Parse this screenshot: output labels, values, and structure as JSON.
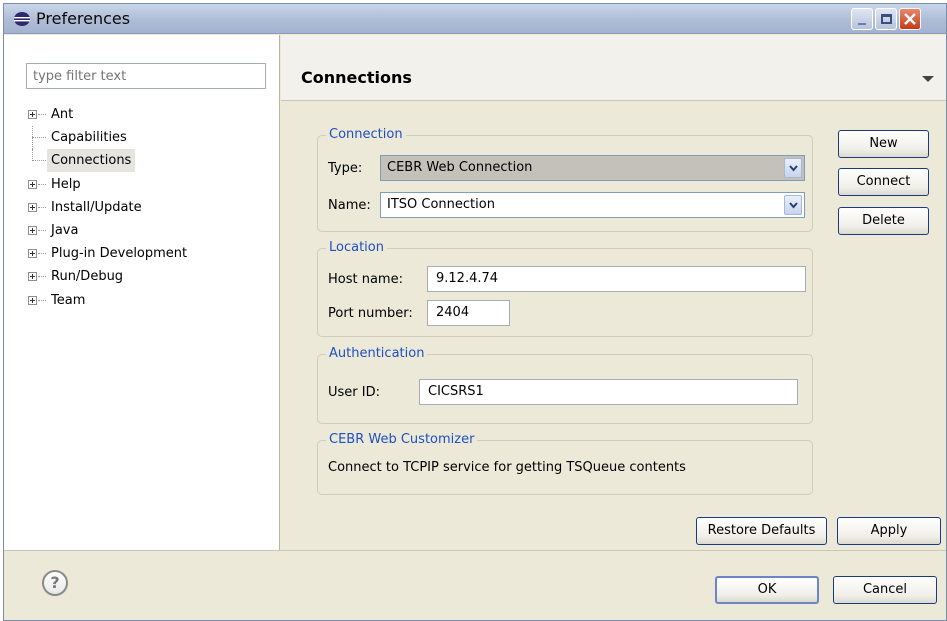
{
  "window": {
    "title": "Preferences",
    "icon": "eclipse-icon"
  },
  "filter": {
    "placeholder": "type filter text"
  },
  "tree": {
    "items": [
      {
        "label": "Ant",
        "expandable": true
      },
      {
        "label": "Capabilities",
        "expandable": false
      },
      {
        "label": "Connections",
        "expandable": false,
        "selected": true
      },
      {
        "label": "Help",
        "expandable": true
      },
      {
        "label": "Install/Update",
        "expandable": true
      },
      {
        "label": "Java",
        "expandable": true
      },
      {
        "label": "Plug-in Development",
        "expandable": true
      },
      {
        "label": "Run/Debug",
        "expandable": true
      },
      {
        "label": "Team",
        "expandable": true
      }
    ]
  },
  "page": {
    "title": "Connections"
  },
  "connection": {
    "title": "Connection",
    "type_label": "Type:",
    "type_value": "CEBR Web Connection",
    "name_label": "Name:",
    "name_value": "ITSO Connection"
  },
  "location": {
    "title": "Location",
    "host_label": "Host name:",
    "host_value": "9.12.4.74",
    "port_label": "Port number:",
    "port_value": "2404"
  },
  "authentication": {
    "title": "Authentication",
    "userid_label": "User ID:",
    "userid_value": "CICSRS1"
  },
  "customizer": {
    "title": "CEBR Web Customizer",
    "description": "Connect to TCPIP service for getting TSQueue contents"
  },
  "side_buttons": {
    "new": "New",
    "connect": "Connect",
    "delete": "Delete"
  },
  "page_buttons": {
    "restore": "Restore Defaults",
    "apply": "Apply"
  },
  "dialog_buttons": {
    "ok": "OK",
    "cancel": "Cancel"
  },
  "colors": {
    "group_title": "#1f4fc1",
    "close_button": "#c43c16"
  }
}
